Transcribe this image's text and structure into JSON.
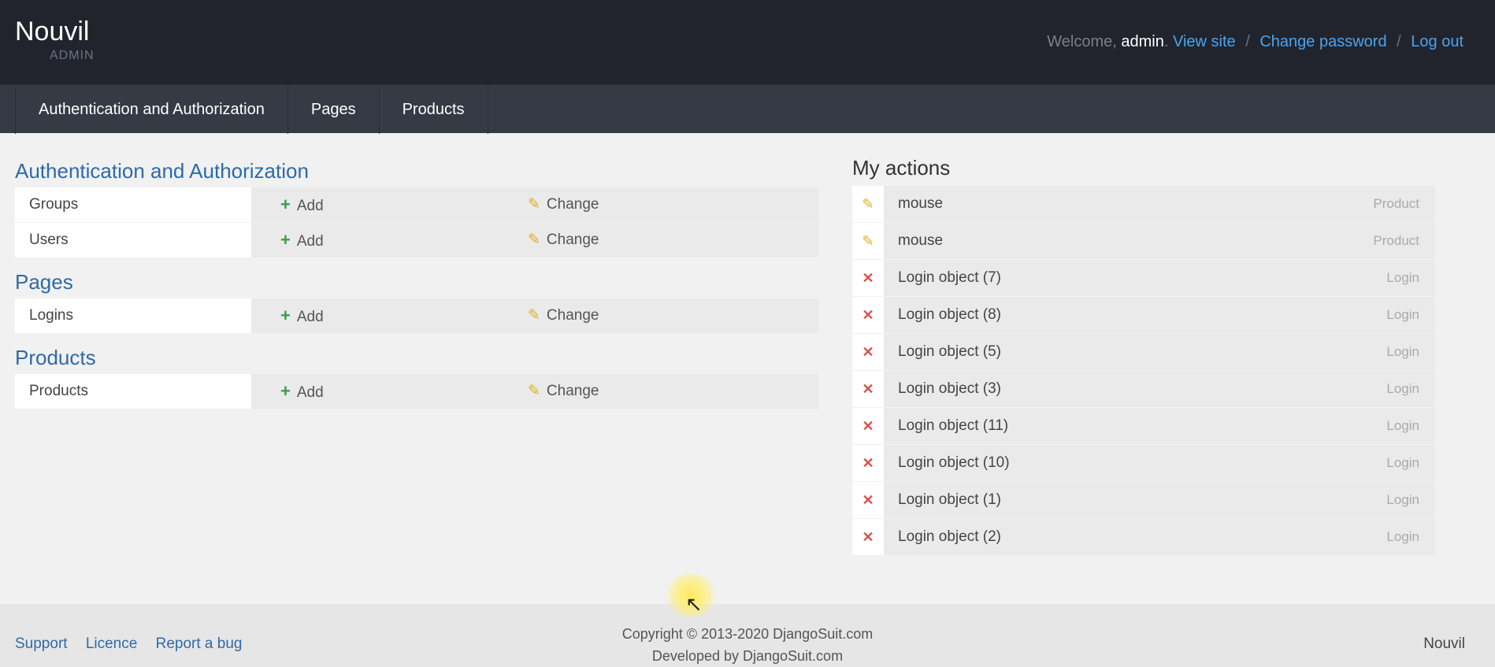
{
  "header": {
    "brand": "Nouvil",
    "brand_sub": "ADMIN",
    "welcome": "Welcome,",
    "username": "admin",
    "view_site": "View site",
    "change_password": "Change password",
    "logout": "Log out",
    "separator": "/"
  },
  "nav": {
    "tabs": [
      "Authentication and Authorization",
      "Pages",
      "Products"
    ]
  },
  "apps": [
    {
      "title": "Authentication and Authorization",
      "models": [
        {
          "name": "Groups",
          "add": "Add",
          "change": "Change"
        },
        {
          "name": "Users",
          "add": "Add",
          "change": "Change"
        }
      ]
    },
    {
      "title": "Pages",
      "models": [
        {
          "name": "Logins",
          "add": "Add",
          "change": "Change"
        }
      ]
    },
    {
      "title": "Products",
      "models": [
        {
          "name": "Products",
          "add": "Add",
          "change": "Change"
        }
      ]
    }
  ],
  "icons": {
    "add": "plus-icon",
    "change": "pencil-icon",
    "delete": "x-icon"
  },
  "actions": {
    "title": "My actions",
    "items": [
      {
        "icon": "pencil-icon",
        "label": "mouse",
        "type": "Product"
      },
      {
        "icon": "pencil-icon",
        "label": "mouse",
        "type": "Product"
      },
      {
        "icon": "x-icon",
        "label": "Login object (7)",
        "type": "Login"
      },
      {
        "icon": "x-icon",
        "label": "Login object (8)",
        "type": "Login"
      },
      {
        "icon": "x-icon",
        "label": "Login object (5)",
        "type": "Login"
      },
      {
        "icon": "x-icon",
        "label": "Login object (3)",
        "type": "Login"
      },
      {
        "icon": "x-icon",
        "label": "Login object (11)",
        "type": "Login"
      },
      {
        "icon": "x-icon",
        "label": "Login object (10)",
        "type": "Login"
      },
      {
        "icon": "x-icon",
        "label": "Login object (1)",
        "type": "Login"
      },
      {
        "icon": "x-icon",
        "label": "Login object (2)",
        "type": "Login"
      }
    ]
  },
  "footer": {
    "support": "Support",
    "licence": "Licence",
    "report_bug": "Report a bug",
    "copyright": "Copyright © 2013-2020 DjangoSuit.com",
    "developed": "Developed by DjangoSuit.com",
    "brand": "Nouvil"
  },
  "colors": {
    "header_bg": "#21242c",
    "nav_bg": "#353a45",
    "link": "#4aa3f0",
    "section_title": "#2e6aa8",
    "add_green": "#3a9d4a",
    "change_yellow": "#e0b020",
    "delete_red": "#d9534f"
  }
}
